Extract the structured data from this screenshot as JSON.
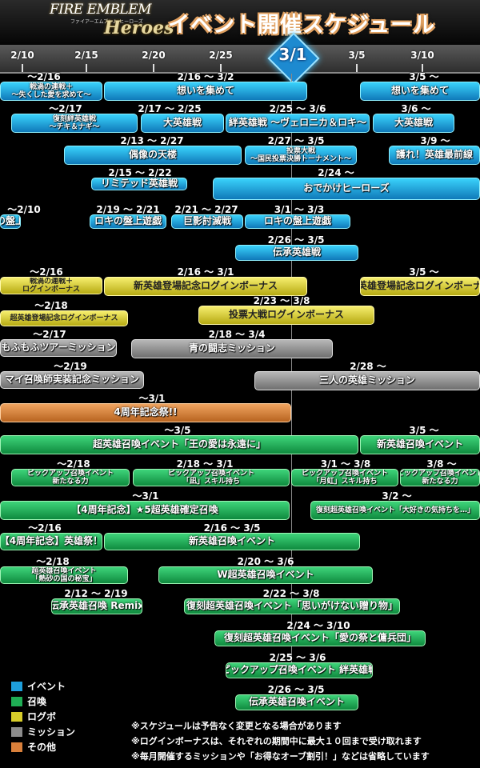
{
  "header": {
    "logo_main": "FIRE EMBLEM",
    "logo_sub": "ファイアーエムブレム ヒーローズ",
    "logo_heroes": "Heroes",
    "title": "イベント開催スケジュール"
  },
  "timeline": {
    "dates": [
      "2/10",
      "2/15",
      "2/20",
      "2/25",
      "3/5",
      "3/10"
    ],
    "today": "3/1"
  },
  "colors": {
    "event": "#1e9fdc",
    "summon": "#1fae55",
    "login": "#d8cd2a",
    "mission": "#8c8c8c",
    "other": "#d9803b"
  },
  "bars": [
    {
      "cat": "event",
      "dates": "～2/16",
      "lines": [
        "戦渦の連戦＋",
        "～失くした愛を求めて～"
      ]
    },
    {
      "cat": "event",
      "dates": "2/16 ～ 3/2",
      "lines": [
        "想いを集めて"
      ]
    },
    {
      "cat": "event",
      "dates": "3/5 ～",
      "lines": [
        "想いを集めて"
      ]
    },
    {
      "cat": "event",
      "dates": "～2/17",
      "lines": [
        "復刻絆英雄戦",
        "～チキ＆ナギ～"
      ]
    },
    {
      "cat": "event",
      "dates": "2/17 ～ 2/25",
      "lines": [
        "大英雄戦"
      ]
    },
    {
      "cat": "event",
      "dates": "2/25 ～ 3/6",
      "lines": [
        "絆英雄戦 ～ヴェロニカ＆ロキ～"
      ]
    },
    {
      "cat": "event",
      "dates": "3/6 ～",
      "lines": [
        "大英雄戦"
      ]
    },
    {
      "cat": "event",
      "dates": "2/13 ～ 2/27",
      "lines": [
        "偶像の天楼"
      ]
    },
    {
      "cat": "event",
      "dates": "2/27 ～ 3/5",
      "lines": [
        "投票大戦",
        "～国民投票決勝トーナメント～"
      ]
    },
    {
      "cat": "event",
      "dates": "3/9 ～",
      "lines": [
        "護れ！英雄最前線"
      ]
    },
    {
      "cat": "event",
      "dates": "2/15 ～ 2/22",
      "lines": [
        "リミテッド英雄戦"
      ]
    },
    {
      "cat": "event",
      "dates": "2/24 ～",
      "lines": [
        "おでかけヒーローズ"
      ]
    },
    {
      "cat": "event",
      "dates": "～2/10",
      "lines": [
        "ロキの盤上遊戯"
      ]
    },
    {
      "cat": "event",
      "dates": "2/19 ～ 2/21",
      "lines": [
        "ロキの盤上遊戯"
      ]
    },
    {
      "cat": "event",
      "dates": "2/21 ～ 2/27",
      "lines": [
        "巨影討滅戦"
      ]
    },
    {
      "cat": "event",
      "dates": "3/1 ～ 3/3",
      "lines": [
        "ロキの盤上遊戯"
      ]
    },
    {
      "cat": "event",
      "dates": "2/26 ～ 3/5",
      "lines": [
        "伝承英雄戦"
      ]
    },
    {
      "cat": "login",
      "dates": "～2/16",
      "lines": [
        "戦渦の連戦＋",
        "ログインボーナス"
      ]
    },
    {
      "cat": "login",
      "dates": "2/16 ～ 3/1",
      "lines": [
        "新英雄登場記念ログインボーナス"
      ]
    },
    {
      "cat": "login",
      "dates": "3/5 ～",
      "lines": [
        "新英雄登場記念ログインボーナス"
      ]
    },
    {
      "cat": "login",
      "dates": "～2/18",
      "lines": [
        "超英雄登場記念ログインボーナス"
      ]
    },
    {
      "cat": "login",
      "dates": "2/23 ～ 3/8",
      "lines": [
        "投票大戦ログインボーナス"
      ]
    },
    {
      "cat": "mission",
      "dates": "～2/17",
      "lines": [
        "もふもふツアーミッション"
      ]
    },
    {
      "cat": "mission",
      "dates": "2/18 ～ 3/4",
      "lines": [
        "青の闘志ミッション"
      ]
    },
    {
      "cat": "mission",
      "dates": "～2/19",
      "lines": [
        "マイ召喚師実装記念ミッション"
      ]
    },
    {
      "cat": "mission",
      "dates": "2/28 ～",
      "lines": [
        "三人の英雄ミッション"
      ]
    },
    {
      "cat": "other",
      "dates": "～3/1",
      "lines": [
        "4周年記念祭!!"
      ]
    },
    {
      "cat": "summon",
      "dates": "～3/5",
      "lines": [
        "超英雄召喚イベント「王の愛は永遠に」"
      ]
    },
    {
      "cat": "summon",
      "dates": "3/5 ～",
      "lines": [
        "新英雄召喚イベント"
      ]
    },
    {
      "cat": "summon",
      "dates": "～2/18",
      "lines": [
        "ピックアップ召喚イベント",
        "新たなる力"
      ]
    },
    {
      "cat": "summon",
      "dates": "2/18 ～ 3/1",
      "lines": [
        "ピックアップ召喚イベント",
        "「凪」スキル持ち"
      ]
    },
    {
      "cat": "summon",
      "dates": "3/1 ～ 3/8",
      "lines": [
        "ピックアップ召喚イベント",
        "「月虹」スキル持ち"
      ]
    },
    {
      "cat": "summon",
      "dates": "3/8 ～",
      "lines": [
        "ピックアップ召喚イベント",
        "新たなる力"
      ]
    },
    {
      "cat": "summon",
      "dates": "～3/1",
      "lines": [
        "【4周年記念】★5超英雄確定召喚"
      ]
    },
    {
      "cat": "summon",
      "dates": "3/2 ～",
      "lines": [
        "復刻超英雄召喚イベント「大好きの気持ちを…」"
      ]
    },
    {
      "cat": "summon",
      "dates": "～2/16",
      "lines": [
        "【4周年記念】英雄祭！"
      ]
    },
    {
      "cat": "summon",
      "dates": "2/16 ～ 3/5",
      "lines": [
        "新英雄召喚イベント"
      ]
    },
    {
      "cat": "summon",
      "dates": "～2/18",
      "lines": [
        "超英雄召喚イベント",
        "「熱砂の国の秘宝」"
      ]
    },
    {
      "cat": "summon",
      "dates": "2/20 ～ 3/6",
      "lines": [
        "W超英雄召喚イベント"
      ]
    },
    {
      "cat": "summon",
      "dates": "2/12 ～ 2/19",
      "lines": [
        "伝承英雄召喚 Remix"
      ]
    },
    {
      "cat": "summon",
      "dates": "2/22 ～ 3/8",
      "lines": [
        "復刻超英雄召喚イベント「思いがけない贈り物」"
      ]
    },
    {
      "cat": "summon",
      "dates": "2/24 ～ 3/10",
      "lines": [
        "復刻超英雄召喚イベント「愛の祭と傭兵団」"
      ]
    },
    {
      "cat": "summon",
      "dates": "2/25 ～ 3/6",
      "lines": [
        "ピックアップ召喚イベント 絆英雄戦"
      ]
    },
    {
      "cat": "summon",
      "dates": "2/26 ～ 3/5",
      "lines": [
        "伝承英雄召喚イベント"
      ]
    }
  ],
  "legend": [
    {
      "label": "イベント",
      "color": "#1e9fdc"
    },
    {
      "label": "召喚",
      "color": "#1fae55"
    },
    {
      "label": "ログボ",
      "color": "#d8cd2a"
    },
    {
      "label": "ミッション",
      "color": "#8c8c8c"
    },
    {
      "label": "その他",
      "color": "#d9803b"
    }
  ],
  "notes": [
    "※スケジュールは予告なく変更となる場合があります",
    "※ログインボーナスは、それぞれの期間中に最大１０回まで受け取れます",
    "※毎月開催するミッションや「お得なオーブ割引！」などは省略しています"
  ]
}
